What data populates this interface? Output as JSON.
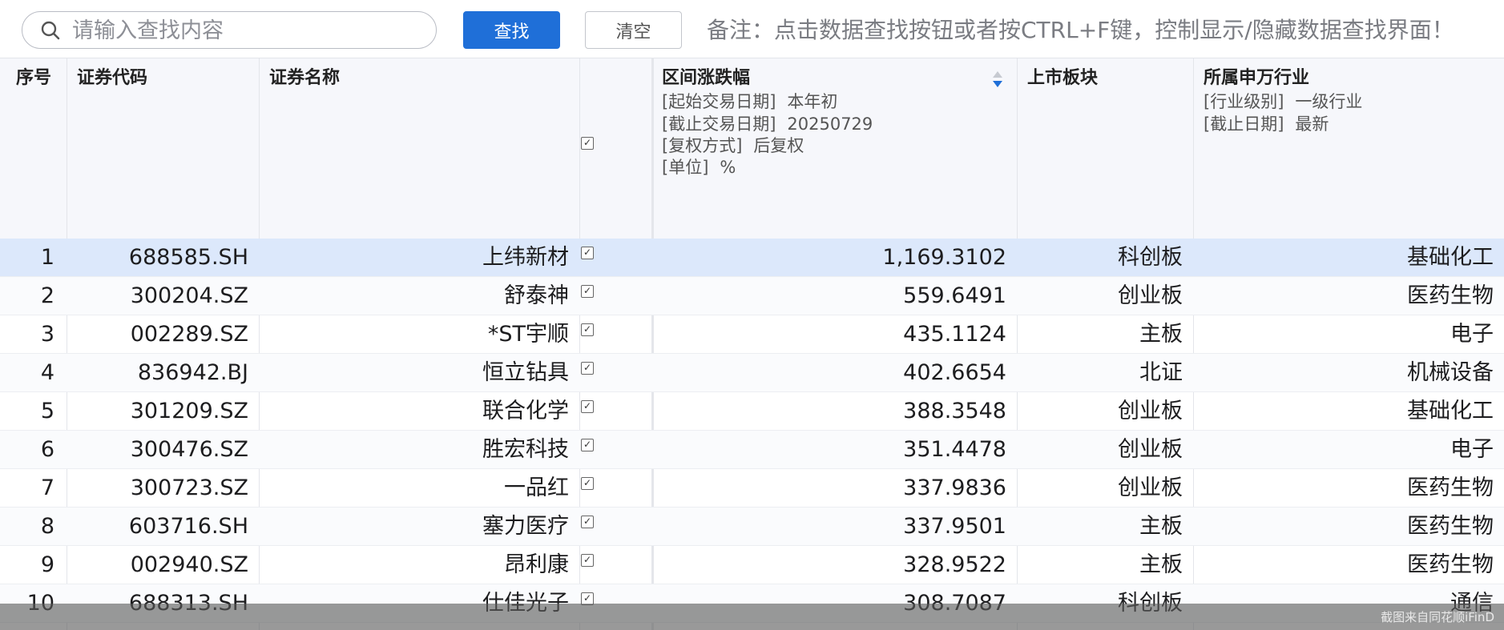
{
  "toolbar": {
    "search_placeholder": "请输入查找内容",
    "search_value": "",
    "find_label": "查找",
    "clear_label": "清空",
    "note": "备注：点击数据查找按钮或者按CTRL+F键，控制显示/隐藏数据查找界面！"
  },
  "columns": {
    "index": "序号",
    "code": "证券代码",
    "name": "证券名称",
    "change": {
      "title": "区间涨跌幅",
      "params": [
        {
          "key": "[起始交易日期]",
          "value": "本年初"
        },
        {
          "key": "[截止交易日期]",
          "value": "20250729"
        },
        {
          "key": "[复权方式]",
          "value": "后复权"
        },
        {
          "key": "[单位]",
          "value": "%"
        }
      ]
    },
    "board": "上市板块",
    "industry": {
      "title": "所属申万行业",
      "params": [
        {
          "key": "[行业级别]",
          "value": "一级行业"
        },
        {
          "key": "[截止日期]",
          "value": "最新"
        }
      ]
    }
  },
  "rows": [
    {
      "index": "1",
      "code": "688585.SH",
      "name": "上纬新材",
      "change": "1,169.3102",
      "board": "科创板",
      "industry": "基础化工",
      "checked": true
    },
    {
      "index": "2",
      "code": "300204.SZ",
      "name": "舒泰神",
      "change": "559.6491",
      "board": "创业板",
      "industry": "医药生物",
      "checked": true
    },
    {
      "index": "3",
      "code": "002289.SZ",
      "name": "*ST宇顺",
      "change": "435.1124",
      "board": "主板",
      "industry": "电子",
      "checked": true
    },
    {
      "index": "4",
      "code": "836942.BJ",
      "name": "恒立钻具",
      "change": "402.6654",
      "board": "北证",
      "industry": "机械设备",
      "checked": true
    },
    {
      "index": "5",
      "code": "301209.SZ",
      "name": "联合化学",
      "change": "388.3548",
      "board": "创业板",
      "industry": "基础化工",
      "checked": true
    },
    {
      "index": "6",
      "code": "300476.SZ",
      "name": "胜宏科技",
      "change": "351.4478",
      "board": "创业板",
      "industry": "电子",
      "checked": true
    },
    {
      "index": "7",
      "code": "300723.SZ",
      "name": "一品红",
      "change": "337.9836",
      "board": "创业板",
      "industry": "医药生物",
      "checked": true
    },
    {
      "index": "8",
      "code": "603716.SH",
      "name": "塞力医疗",
      "change": "337.9501",
      "board": "主板",
      "industry": "医药生物",
      "checked": true
    },
    {
      "index": "9",
      "code": "002940.SZ",
      "name": "昂利康",
      "change": "328.9522",
      "board": "主板",
      "industry": "医药生物",
      "checked": true
    },
    {
      "index": "10",
      "code": "688313.SH",
      "name": "仕佳光子",
      "change": "308.7087",
      "board": "科创板",
      "industry": "通信",
      "checked": true
    }
  ],
  "selected_row": 1,
  "header_checkbox_checked": true,
  "icons": {
    "search": "search-icon",
    "sort": "sort-desc-icon",
    "checkbox": "checkbox-checked-icon"
  },
  "colors": {
    "accent": "#1f6fd8",
    "selected_row": "#dce8fb",
    "header_bg": "#f6f7fb"
  },
  "watermark": "截图来自同花顺iFinD"
}
